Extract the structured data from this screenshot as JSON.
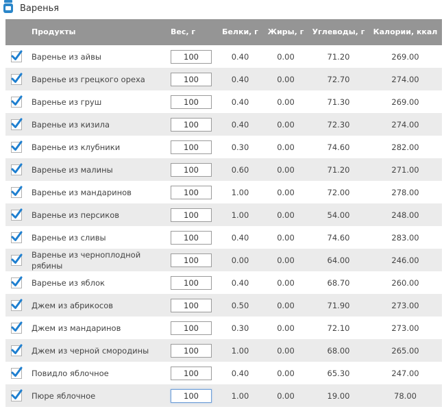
{
  "section": {
    "title": "Варенья",
    "icon": "jar-icon"
  },
  "columns": {
    "product": "Продукты",
    "weight": "Вес, г",
    "protein": "Белки, г",
    "fat": "Жиры, г",
    "carbs": "Углеводы, г",
    "calories": "Калории, ккал"
  },
  "rows": [
    {
      "name": "Варенье из айвы",
      "weight": "100",
      "protein": "0.40",
      "fat": "0.00",
      "carbs": "71.20",
      "calories": "269.00"
    },
    {
      "name": "Варенье из грецкого ореха",
      "weight": "100",
      "protein": "0.40",
      "fat": "0.00",
      "carbs": "72.70",
      "calories": "274.00"
    },
    {
      "name": "Варенье из груш",
      "weight": "100",
      "protein": "0.40",
      "fat": "0.00",
      "carbs": "71.30",
      "calories": "269.00"
    },
    {
      "name": "Варенье из кизила",
      "weight": "100",
      "protein": "0.40",
      "fat": "0.00",
      "carbs": "72.30",
      "calories": "274.00"
    },
    {
      "name": "Варенье из клубники",
      "weight": "100",
      "protein": "0.30",
      "fat": "0.00",
      "carbs": "74.60",
      "calories": "282.00"
    },
    {
      "name": "Варенье из малины",
      "weight": "100",
      "protein": "0.60",
      "fat": "0.00",
      "carbs": "71.20",
      "calories": "271.00"
    },
    {
      "name": "Варенье из мандаринов",
      "weight": "100",
      "protein": "1.00",
      "fat": "0.00",
      "carbs": "72.00",
      "calories": "278.00"
    },
    {
      "name": "Варенье из персиков",
      "weight": "100",
      "protein": "1.00",
      "fat": "0.00",
      "carbs": "54.00",
      "calories": "248.00"
    },
    {
      "name": "Варенье из сливы",
      "weight": "100",
      "protein": "0.40",
      "fat": "0.00",
      "carbs": "74.60",
      "calories": "283.00"
    },
    {
      "name": "Варенье из черноплодной рябины",
      "weight": "100",
      "protein": "0.00",
      "fat": "0.00",
      "carbs": "64.00",
      "calories": "246.00"
    },
    {
      "name": "Варенье из яблок",
      "weight": "100",
      "protein": "0.40",
      "fat": "0.00",
      "carbs": "68.70",
      "calories": "260.00"
    },
    {
      "name": "Джем из абрикосов",
      "weight": "100",
      "protein": "0.50",
      "fat": "0.00",
      "carbs": "71.90",
      "calories": "273.00"
    },
    {
      "name": "Джем из мандаринов",
      "weight": "100",
      "protein": "0.30",
      "fat": "0.00",
      "carbs": "72.10",
      "calories": "273.00"
    },
    {
      "name": "Джем из черной смородины",
      "weight": "100",
      "protein": "1.00",
      "fat": "0.00",
      "carbs": "68.00",
      "calories": "265.00"
    },
    {
      "name": "Повидло яблочное",
      "weight": "100",
      "protein": "0.40",
      "fat": "0.00",
      "carbs": "65.30",
      "calories": "247.00"
    },
    {
      "name": "Пюре яблочное",
      "weight": "100",
      "protein": "1.00",
      "fat": "0.00",
      "carbs": "19.00",
      "calories": "78.00"
    }
  ],
  "checkbox_state": "checked",
  "colors": {
    "header_bg": "#959595",
    "row_alt_bg": "#ebebeb",
    "check_color": "#1e7fd0",
    "icon_color": "#2a86c9"
  }
}
